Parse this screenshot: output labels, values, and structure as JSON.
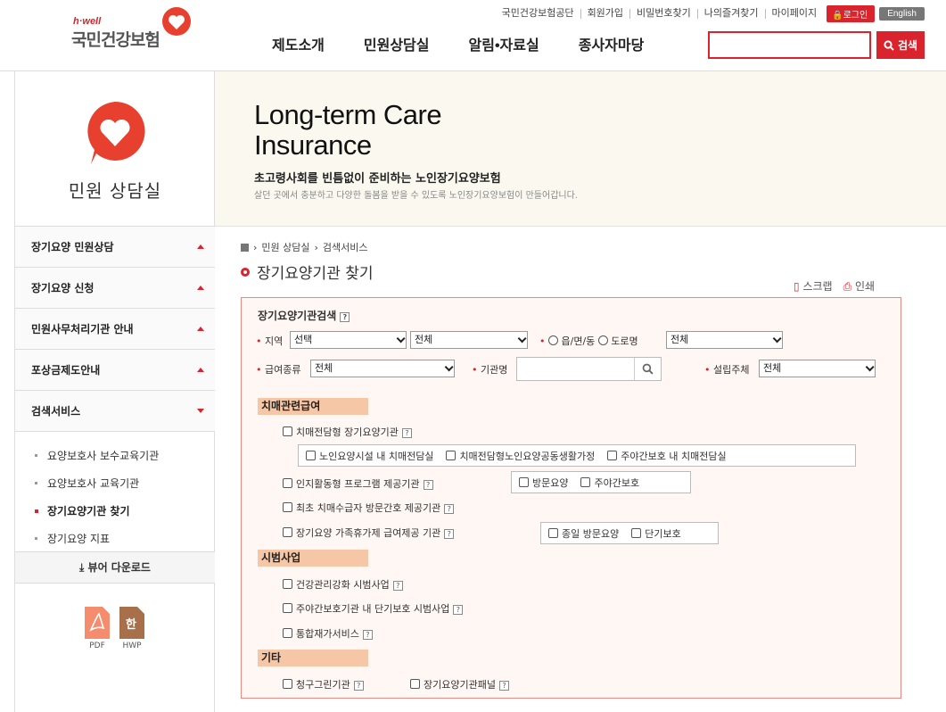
{
  "header": {
    "logo_small": "h·well",
    "logo_name": "국민건강보험",
    "util_links": [
      "국민건강보험공단",
      "회원가입",
      "비밀번호찾기",
      "나의즐겨찾기",
      "마이페이지"
    ],
    "login": "로그인",
    "english": "English",
    "gnb": [
      "제도소개",
      "민원상담실",
      "알림•자료실",
      "종사자마당"
    ],
    "search_btn": "검색",
    "search_value": ""
  },
  "sidebar": {
    "title": "민원 상담실",
    "menus": [
      "장기요양 민원상담",
      "장기요양 신청",
      "민원사무처리기관 안내",
      "포상금제도안내",
      "검색서비스"
    ],
    "subs": [
      "요양보호사 보수교육기관",
      "요양보호사 교육기관",
      "장기요양기관 찾기",
      "장기요양 지표"
    ],
    "viewer": "⤓ 뷰어 다운로드",
    "pdf": "PDF",
    "hwp": "HWP",
    "hwp_glyph": "한"
  },
  "banner": {
    "en1": "Long-term Care",
    "en2": "Insurance",
    "ko": "초고령사회를 빈틈없이 준비하는 노인장기요양보험",
    "desc": "살던 곳에서 충분하고 다양한 돌봄을 받을 수 있도록 노인장기요양보험이 만들어갑니다."
  },
  "breadcrumb": [
    "민원 상담실",
    "검색서비스"
  ],
  "page_title": "장기요양기관 찾기",
  "tools": {
    "scrap": "스크랩",
    "print": "인쇄"
  },
  "form": {
    "heading": "장기요양기관검색",
    "region_label": "지역",
    "region1": "선택",
    "region2": "전체",
    "radio1": "읍/면/동",
    "radio2": "도로명",
    "road": "전체",
    "benefit_label": "급여종류",
    "benefit": "전체",
    "name_label": "기관명",
    "name_value": "",
    "founder_label": "설립주체",
    "founder": "전체"
  },
  "sections": {
    "dementia": "치매관련급여",
    "d1": "치매전담형 장기요양기관",
    "d1a": "노인요양시설 내 치매전담실",
    "d1b": "치매전담형노인요양공동생활가정",
    "d1c": "주야간보호 내 치매전담실",
    "d2": "인지활동형 프로그램 제공기관",
    "d2a": "방문요양",
    "d2b": "주야간보호",
    "d3": "최초 치매수급자 방문간호 제공기관",
    "d4": "장기요양 가족휴가제 급여제공 기관",
    "d4a": "종일 방문요양",
    "d4b": "단기보호",
    "pilot": "시범사업",
    "p1": "건강관리강화 시범사업",
    "p2": "주야간보호기관 내 단기보호 시범사업",
    "p3": "통합재가서비스",
    "etc": "기타",
    "e1": "청구그린기관",
    "e2": "장기요양기관패널"
  }
}
